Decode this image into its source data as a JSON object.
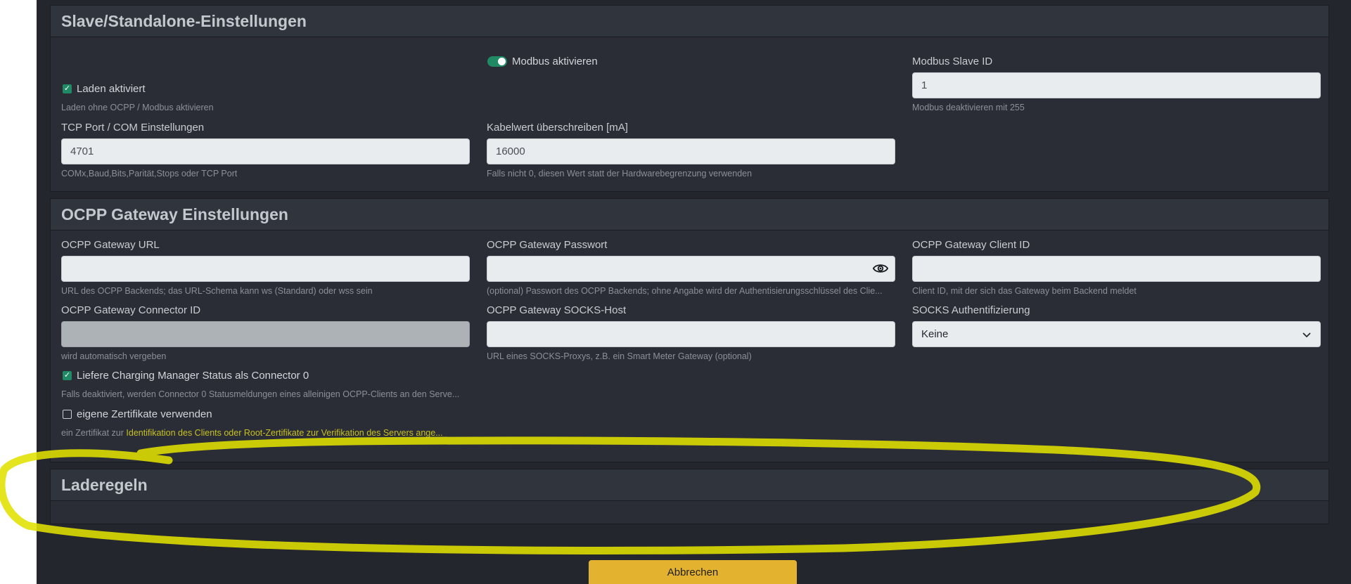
{
  "slave_section": {
    "title": "Slave/Standalone-Einstellungen",
    "charging_enabled_label": "Laden aktiviert",
    "charging_enabled_hint": "Laden ohne OCPP / Modbus aktivieren",
    "charging_enabled_checked": true,
    "modbus_toggle_label": "Modbus aktivieren",
    "modbus_toggle_on": true,
    "modbus_slave_id_label": "Modbus Slave ID",
    "modbus_slave_id_value": "1",
    "modbus_slave_id_hint": "Modbus deaktivieren mit 255",
    "tcp_port_label": "TCP Port / COM Einstellungen",
    "tcp_port_value": "4701",
    "tcp_port_hint": "COMx,Baud,Bits,Parität,Stops oder TCP Port",
    "cable_override_label": "Kabelwert überschreiben [mA]",
    "cable_override_value": "16000",
    "cable_override_hint": "Falls nicht 0, diesen Wert statt der Hardwarebegrenzung verwenden"
  },
  "ocpp_section": {
    "title": "OCPP Gateway Einstellungen",
    "url_label": "OCPP Gateway URL",
    "url_value": "",
    "url_hint": "URL des OCPP Backends; das URL-Schema kann ws (Standard) oder wss sein",
    "password_label": "OCPP Gateway Passwort",
    "password_value": "",
    "password_hint": "(optional) Passwort des OCPP Backends; ohne Angabe wird der Authentisierungsschlüssel des Clie...",
    "client_id_label": "OCPP Gateway Client ID",
    "client_id_value": "",
    "client_id_hint": "Client ID, mit der sich das Gateway beim Backend meldet",
    "connector_id_label": "OCPP Gateway Connector ID",
    "connector_id_value": "",
    "connector_id_hint": "wird automatisch vergeben",
    "socks_host_label": "OCPP Gateway SOCKS-Host",
    "socks_host_value": "",
    "socks_host_hint": "URL eines SOCKS-Proxys, z.B. ein Smart Meter Gateway (optional)",
    "socks_auth_label": "SOCKS Authentifizierung",
    "socks_auth_selected": "Keine",
    "connector0_label": "Liefere Charging Manager Status als Connector 0",
    "connector0_checked": true,
    "connector0_hint": "Falls deaktiviert, werden Connector 0 Statusmeldungen eines alleinigen OCPP-Clients an den Serve...",
    "certs_label": "eigene Zertifikate verwenden",
    "certs_checked": false,
    "certs_hint_prefix": "ein Zertifikat zur ",
    "certs_hint_highlight": "Identifikation des Clients oder Root-Zertifikate zur Verifikation des Servers ange..."
  },
  "rules_section": {
    "title": "Laderegeln"
  },
  "footer": {
    "cancel_label": "Abbrechen"
  },
  "icons": {
    "eye": "eye-icon",
    "chevron": "chevron-down-icon",
    "check": "checkmark-icon"
  },
  "colors": {
    "accent_green": "#1f8a64",
    "cancel_button": "#e3b22e",
    "marker_yellow": "#eaea00",
    "background": "#23262d"
  }
}
